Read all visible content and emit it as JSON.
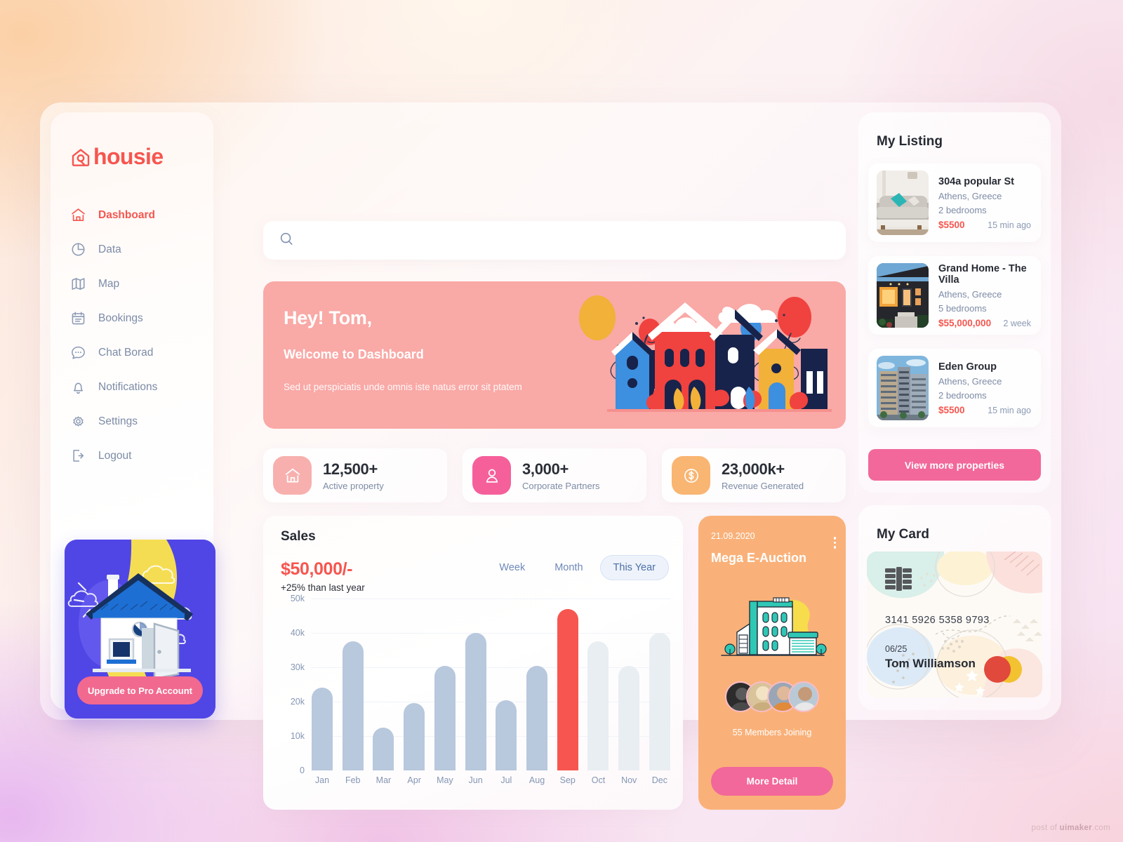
{
  "brand": {
    "name": "housie",
    "accent": "#f6564f",
    "icon": "house-logo-icon"
  },
  "sidebar": {
    "items": [
      {
        "label": "Dashboard",
        "icon": "home-icon",
        "active": true
      },
      {
        "label": "Data",
        "icon": "pie-chart-icon",
        "active": false
      },
      {
        "label": "Map",
        "icon": "map-icon",
        "active": false
      },
      {
        "label": "Bookings",
        "icon": "calendar-icon",
        "active": false
      },
      {
        "label": "Chat Borad",
        "icon": "chat-bubble-icon",
        "active": false
      },
      {
        "label": "Notifications",
        "icon": "bell-icon",
        "active": false
      },
      {
        "label": "Settings",
        "icon": "gear-icon",
        "active": false
      },
      {
        "label": "Logout",
        "icon": "logout-icon",
        "active": false
      }
    ],
    "promo": {
      "button_label": "Upgrade to Pro Account",
      "bg": "#5046e5",
      "button_bg": "#f2698f"
    }
  },
  "search": {
    "value": "",
    "placeholder": "",
    "icon": "search-icon"
  },
  "hero": {
    "greeting": "Hey! Tom,",
    "subtitle": "Welcome to Dashboard",
    "description": "Sed ut perspiciatis unde omnis iste natus error sit ptatem",
    "bg": "#f9a9a6"
  },
  "stats": [
    {
      "value": "12,500+",
      "label": "Active property",
      "icon": "house-icon",
      "color": "#f7b0ae"
    },
    {
      "value": "3,000+",
      "label": "Corporate Partners",
      "icon": "person-icon",
      "color": "#f5609b"
    },
    {
      "value": "23,000k+",
      "label": "Revenue Generated",
      "icon": "dollar-icon",
      "color": "#f9b572"
    }
  ],
  "sales": {
    "title": "Sales",
    "amount": "$50,000/-",
    "delta": "+25% than last year",
    "ranges": [
      {
        "label": "Week",
        "active": false
      },
      {
        "label": "Month",
        "active": false
      },
      {
        "label": "This Year",
        "active": true
      }
    ]
  },
  "chart_data": {
    "type": "bar",
    "title": "Sales",
    "xlabel": "",
    "ylabel": "",
    "ylim": [
      0,
      50000
    ],
    "grid": true,
    "legend_position": "none",
    "categories": [
      "Jan",
      "Feb",
      "Mar",
      "Apr",
      "May",
      "Jun",
      "Jul",
      "Aug",
      "Sep",
      "Oct",
      "Nov",
      "Dec"
    ],
    "tick_labels_y": [
      "0",
      "10k",
      "20k",
      "30k",
      "40k",
      "50k"
    ],
    "values": [
      24000,
      37500,
      12500,
      19500,
      30500,
      40000,
      20500,
      30500,
      47000,
      37500,
      30500,
      40000
    ],
    "series": [
      {
        "name": "Sales",
        "values": [
          24000,
          37500,
          12500,
          19500,
          30500,
          40000,
          20500,
          30500,
          47000,
          37500,
          30500,
          40000
        ]
      }
    ],
    "bar_colors": [
      "#b8c8dd",
      "#b8c8dd",
      "#b8c8dd",
      "#b8c8dd",
      "#b8c8dd",
      "#b8c8dd",
      "#b8c8dd",
      "#b8c8dd",
      "#f6564f",
      "#e9eef3",
      "#e9eef3",
      "#e9eef3"
    ],
    "highlight_index": 8,
    "highlight_color": "#f6564f",
    "bar_color": "#b8c8dd",
    "muted_color": "#e9eef3"
  },
  "auction": {
    "date": "21.09.2020",
    "title": "Mega E-Auction",
    "members": "55 Members Joining",
    "button_label": "More Detail",
    "menu_icon": "kebab-menu-icon",
    "bg": "#f9b179",
    "button_bg": "#f2689a"
  },
  "listing": {
    "title": "My Listing",
    "items": [
      {
        "name": "304a popular St",
        "location": "Athens, Greece",
        "bedrooms": "2 bedrooms",
        "price": "$5500",
        "time": "15 min ago",
        "thumb": "sofa-interior-photo"
      },
      {
        "name": "Grand Home - The Villa",
        "location": "Athens, Greece",
        "bedrooms": "5 bedrooms",
        "price": "$55,000,000",
        "time": "2 week",
        "thumb": "modern-house-photo"
      },
      {
        "name": "Eden Group",
        "location": "Athens, Greece",
        "bedrooms": "2 bedrooms",
        "price": "$5500",
        "time": "15 min ago",
        "thumb": "apartment-block-photo"
      }
    ],
    "button_label": "View more properties"
  },
  "card": {
    "title": "My Card",
    "number": "3141  5926  5358  9793",
    "expiry": "06/25",
    "holder": "Tom Williamson",
    "chip_icon": "card-chip-icon",
    "brand_icon": "mastercard-icon"
  },
  "footer": {
    "watermark_prefix": "post of ",
    "watermark_brand": "uimaker",
    "watermark_suffix": ".com"
  }
}
